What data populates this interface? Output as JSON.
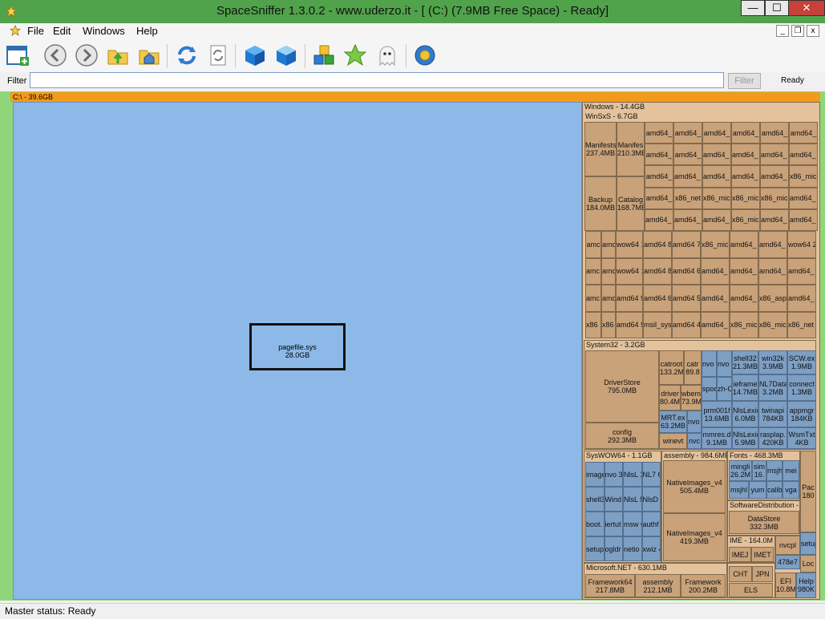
{
  "window": {
    "title": "SpaceSniffer 1.3.0.2 - www.uderzo.it - [ (C:) (7.9MB Free Space) - Ready]",
    "min_label": "—",
    "max_label": "☐",
    "close_label": "✕"
  },
  "menu": {
    "items": [
      "File",
      "Edit",
      "Windows",
      "Help"
    ],
    "mdi_min": "_",
    "mdi_restore": "❐",
    "mdi_close": "x"
  },
  "toolbar": {
    "icons": [
      "new-scan-icon",
      "back-icon",
      "forward-icon",
      "up-folder-icon",
      "home-icon",
      "refresh-icon",
      "refresh-branch-icon",
      "blue-cube-icon",
      "blue-cube-outline-icon",
      "colored-cubes-icon",
      "star-icon",
      "ghost-icon",
      "settings-gear-icon"
    ]
  },
  "filter": {
    "label": "Filter",
    "value": "",
    "button_label": "Filter",
    "status": "Ready"
  },
  "drive": {
    "label": "C:\\ - 39.6GB"
  },
  "treemap": {
    "pagefile": {
      "name": "pagefile.sys",
      "size": "28.0GB"
    },
    "windows_header": "Windows - 14.4GB",
    "winsxs_header": "WinSxS - 6.7GB",
    "system32_header": "System32 - 3.2GB",
    "syswow64_header": "SysWOW64 - 1.1GB",
    "assembly_header": "assembly - 984.6MB",
    "fonts_header": "Fonts - 468.3MB",
    "softdist_header": "SoftwareDistribution -",
    "ime_header": "IME - 164.0M",
    "dotnet_header": "Microsoft.NET - 630.1MB",
    "tiles": [
      {
        "id": "manifests",
        "name": "Manifests",
        "size": "237.4MB"
      },
      {
        "id": "manifests2",
        "name": "Manifes",
        "size": "210.3MB"
      },
      {
        "id": "backup",
        "name": "Backup",
        "size": "184.0MB"
      },
      {
        "id": "catalogs",
        "name": "Catalog",
        "size": "168.7MB"
      },
      {
        "id": "driverstore",
        "name": "DriverStore",
        "size": "795.0MB"
      },
      {
        "id": "config",
        "name": "config",
        "size": "292.3MB"
      },
      {
        "id": "catroot",
        "name": "catroot",
        "size": "133.2MB"
      },
      {
        "id": "catroot2",
        "name": "catr",
        "size": "89.8"
      },
      {
        "id": "drivers",
        "name": "driver",
        "size": "80.4MB"
      },
      {
        "id": "wbem",
        "name": "wbem",
        "size": "73.9MB"
      },
      {
        "id": "mrt",
        "name": "MRT.ex",
        "size": "63.2MB"
      },
      {
        "id": "winevt",
        "name": "winevt",
        "size": ""
      },
      {
        "id": "nativeimages1",
        "name": "NativeImages_v4",
        "size": "505.4MB"
      },
      {
        "id": "nativeimages2",
        "name": "NativeImages_v4",
        "size": "419.3MB"
      },
      {
        "id": "datastore",
        "name": "DataStore",
        "size": "332.3MB"
      },
      {
        "id": "framework64",
        "name": "Framework64",
        "size": "217.8MB"
      },
      {
        "id": "assembly2",
        "name": "assembly",
        "size": "212.1MB"
      },
      {
        "id": "framework",
        "name": "Framework",
        "size": "200.2MB"
      },
      {
        "id": "shell32",
        "name": "shell32",
        "size": "21.3MB"
      },
      {
        "id": "win32k",
        "name": "win32k",
        "size": "3.9MB"
      },
      {
        "id": "scw",
        "name": "SCW.ex",
        "size": "1.9MB"
      },
      {
        "id": "ieframe",
        "name": "ieframe",
        "size": "14.7MB"
      },
      {
        "id": "nl7data",
        "name": "NL7Data",
        "size": "3.2MB"
      },
      {
        "id": "connect",
        "name": "connect",
        "size": "1.3MB"
      },
      {
        "id": "prm",
        "name": "prm001f",
        "size": "13.6MB"
      },
      {
        "id": "twinapi",
        "name": "twinapi",
        "size": "784KB"
      },
      {
        "id": "appmgr",
        "name": "appmgr",
        "size": "184KB"
      },
      {
        "id": "nlslexic1",
        "name": "NlsLexic",
        "size": "6.0MB"
      },
      {
        "id": "mmres",
        "name": "mmres.d",
        "size": "9.1MB"
      },
      {
        "id": "nlslexic2",
        "name": "NlsLexic",
        "size": "5.9MB"
      },
      {
        "id": "rasplap",
        "name": "rasplap.",
        "size": "420KB"
      },
      {
        "id": "wsmtxt",
        "name": "WsmTxt",
        "size": "4KB"
      },
      {
        "id": "mingliu",
        "name": "mingli",
        "size": "26.2M"
      },
      {
        "id": "simsun",
        "name": "sim",
        "size": "16."
      },
      {
        "id": "msjh",
        "name": "msjh",
        "size": ""
      },
      {
        "id": "meiryo",
        "name": "mei",
        "size": ""
      },
      {
        "id": "msjhl",
        "name": "msjhl",
        "size": ""
      },
      {
        "id": "yumin",
        "name": "yum",
        "size": ""
      },
      {
        "id": "calibri",
        "name": "calib",
        "size": ""
      },
      {
        "id": "verdana",
        "name": "vga",
        "size": ""
      },
      {
        "id": "nvcpl",
        "name": "nvcpl",
        "size": ""
      },
      {
        "id": "cht",
        "name": "CHT",
        "size": ""
      },
      {
        "id": "jpn",
        "name": "JPN",
        "size": ""
      },
      {
        "id": "els",
        "name": "ELS",
        "size": ""
      },
      {
        "id": "efi",
        "name": "EFI",
        "size": "10.8M"
      },
      {
        "id": "help",
        "name": "Help",
        "size": "980K"
      },
      {
        "id": "imejp",
        "name": "IMEJ",
        "size": ""
      },
      {
        "id": "imetc",
        "name": "IMET",
        "size": ""
      },
      {
        "id": "pac",
        "name": "Pac",
        "size": "180"
      },
      {
        "id": "setup",
        "name": "setup",
        "size": ""
      },
      {
        "id": "loc",
        "name": "Loc",
        "size": ""
      },
      {
        "id": "x478",
        "name": "478e7",
        "size": ""
      }
    ],
    "winsxs_grid": [
      [
        "amd64_",
        "amd64_",
        "amd64_",
        "amd64_",
        "amd64_",
        "amd64_"
      ],
      [
        "amd64_",
        "amd64_",
        "amd64_ 4.5MB",
        "amd64_ 3.3MB",
        "amd64_ 1.8MB",
        "amd64_ 1.4MB"
      ],
      [
        "amd64_",
        "amd64_ 27.9MB",
        "amd64_ 3.7MB",
        "amd64_ 3.1MB",
        "amd64_ 1.6MB",
        "x86_mic 1.3MB"
      ],
      [
        "amd64_",
        "x86_net",
        "x86_mic 2.8MB",
        "x86_mic 2.2MB",
        "x86_mic 1.2MB",
        "amd64_ 1.0MB"
      ],
      [
        "amd64_ 20.8MB",
        "amd64_ 18.5MB",
        "amd64_ 2.6MB",
        "x86_mic 2.0MB",
        "amd64_ 1.1MB",
        "amd64_ 996KB"
      ]
    ],
    "winsxs_rows": [
      [
        "amc",
        "amc",
        "wow64 13.2MB",
        "amd64 8.8MB",
        "amd64 7.5MB",
        "x86_mic 944KB",
        "amd64_ 756KB",
        "amd64_ 332KB",
        "wow64 224KB"
      ],
      [
        "amc 14.9",
        "amc 14.7",
        "wow64 12.2MB",
        "amd64 8.2MB",
        "amd64 6.9MB",
        "amd64_ 872KB",
        "amd64_ 664KB",
        "amd64_ 280KB",
        "amd64_ 172KB"
      ],
      [
        "amc 11.6",
        "amc 11.0",
        "amd64 9.8MB",
        "amd64 6.1MB",
        "amd64 5.4MB",
        "amd64_ 592KB",
        "amd64_ 460KB",
        "x86_asp 128KB",
        "amd64_ 40KB"
      ],
      [
        "x86 10.5",
        "x86 10.3",
        "amd64 9.2MB",
        "msil_sys 5.7MB",
        "amd64 4.7MB",
        "amd64_ 520KB",
        "x86_mic 396KB",
        "x86_mic 80KB",
        "x86_net 4KB"
      ]
    ],
    "sysblue": [
      "nvo 37.6",
      "nvo 33.4",
      "spoo 25.1",
      "zh-C 23.4",
      "nvo 46.1",
      "nvc"
    ],
    "wow_tiles": [
      "image 46.5M",
      "nvo 33.6",
      "NlsL 11.4",
      "NL7 6.9M",
      "shell32 18.8M",
      "Wind 14.4",
      "NlsL 5.3M",
      "NlsD 4.3M",
      "boot. 3.0M",
      "iertut 2.2M",
      "msw 628K",
      "authf 356K",
      "setup 1.7M",
      "ogldr 1.0M",
      "netio 168K",
      "xwiz 4KB"
    ]
  },
  "status": {
    "text": "Master status: Ready"
  }
}
